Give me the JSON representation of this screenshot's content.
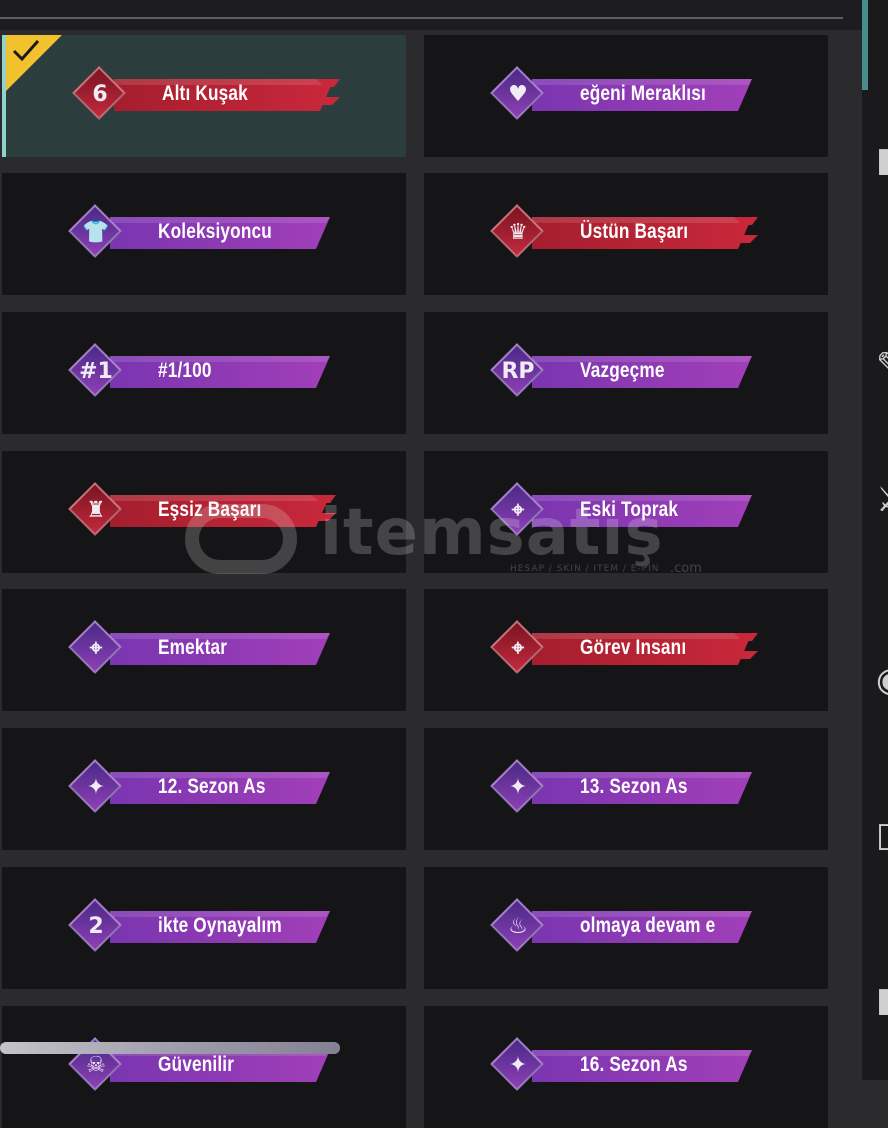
{
  "colors": {
    "purple_ribbon": "#7a35b0",
    "purple_ribbon_end": "#a13fb8",
    "red_ribbon": "#a51e2e",
    "red_ribbon_end": "#c8283a",
    "selected_bg": "#2c3d3e",
    "selected_accent": "#8fd3cf",
    "check_yellow": "#f2c12e"
  },
  "titles": [
    {
      "label": "Altı Kuşak",
      "style": "red",
      "icon": "number-six-trophy-icon",
      "glyph": "6",
      "selected": true
    },
    {
      "label": "eğeni Meraklısı",
      "style": "purple",
      "icon": "hearts-icon",
      "glyph": "♥",
      "selected": false
    },
    {
      "label": "Koleksiyoncu",
      "style": "purple",
      "icon": "outfit-icon",
      "glyph": "👕",
      "selected": false
    },
    {
      "label": "Üstün Başarı",
      "style": "red",
      "icon": "strong-figure-icon",
      "glyph": "♛",
      "selected": false
    },
    {
      "label": "#1/100",
      "style": "purple",
      "icon": "number-one-icon",
      "glyph": "#1",
      "selected": false
    },
    {
      "label": "Vazgeçme",
      "style": "purple",
      "icon": "rp-wings-icon",
      "glyph": "RP",
      "selected": false
    },
    {
      "label": "Eşsiz Başarı",
      "style": "red",
      "icon": "flexing-figure-icon",
      "glyph": "♜",
      "selected": false
    },
    {
      "label": "Eski Toprak",
      "style": "purple",
      "icon": "crosshair-gun-icon",
      "glyph": "⌖",
      "selected": false
    },
    {
      "label": "Emektar",
      "style": "purple",
      "icon": "crosshair-gun-icon",
      "glyph": "⌖",
      "selected": false
    },
    {
      "label": "Görev Insanı",
      "style": "red",
      "icon": "crosshair-gun-icon",
      "glyph": "⌖",
      "selected": false
    },
    {
      "label": "12. Sezon As",
      "style": "purple",
      "icon": "ace-wings-icon",
      "glyph": "✦",
      "selected": false
    },
    {
      "label": "13. Sezon As",
      "style": "purple",
      "icon": "ace-wings-icon",
      "glyph": "✦",
      "selected": false
    },
    {
      "label": "ikte Oynayalım",
      "style": "purple",
      "icon": "number-two-icon",
      "glyph": "2",
      "selected": false
    },
    {
      "label": "olmaya devam e",
      "style": "purple",
      "icon": "cake-icon",
      "glyph": "♨",
      "selected": false
    },
    {
      "label": "Güvenilir",
      "style": "purple",
      "icon": "skull-icon",
      "glyph": "☠",
      "selected": false
    },
    {
      "label": "16. Sezon As",
      "style": "purple",
      "icon": "ace-wings-icon",
      "glyph": "✦",
      "selected": false
    }
  ],
  "watermark": {
    "brand": "itemsatış",
    "tagline": "HESAP / SKIN / ITEM / E-PIN",
    "suffix": ".com"
  },
  "side_glyphs": [
    "▮",
    "✎",
    "⚔",
    "◉",
    "▯",
    "▮"
  ]
}
